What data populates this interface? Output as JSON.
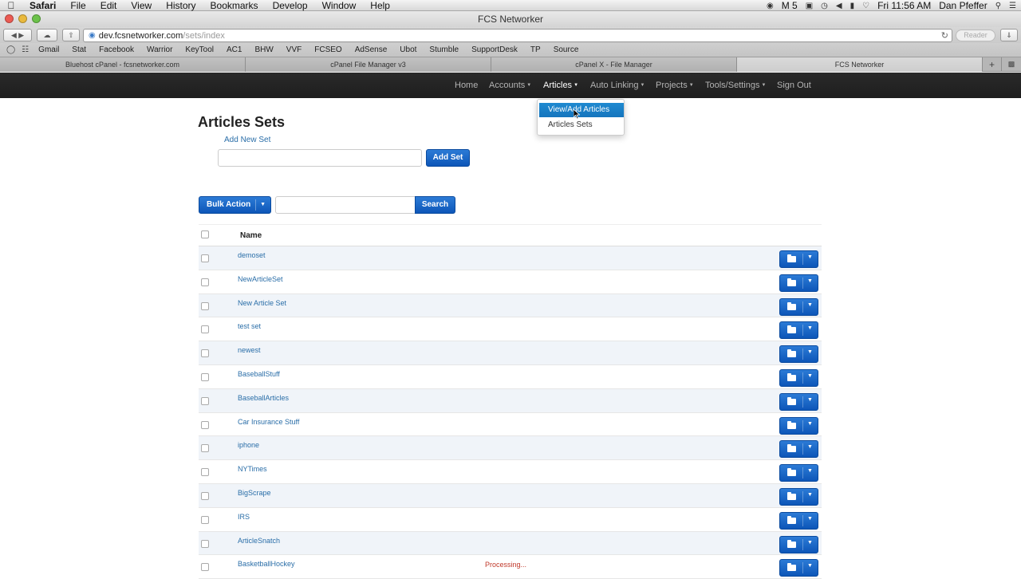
{
  "menubar": {
    "items": [
      "Safari",
      "File",
      "Edit",
      "View",
      "History",
      "Bookmarks",
      "Develop",
      "Window",
      "Help"
    ],
    "clock": "Fri 11:56 AM",
    "user": "Dan Pfeffer",
    "m5": "M 5"
  },
  "window": {
    "title": "FCS Networker"
  },
  "address": {
    "host": "dev.fcsnetworker.com",
    "path": "/sets/index",
    "reader": "Reader"
  },
  "bookmarks": [
    "Gmail",
    "Stat",
    "Facebook",
    "Warrior",
    "KeyTool",
    "AC1",
    "BHW",
    "VVF",
    "FCSEO",
    "AdSense",
    "Ubot",
    "Stumble",
    "SupportDesk",
    "TP",
    "Source"
  ],
  "tabs": [
    "Bluehost cPanel - fcsnetworker.com",
    "cPanel File Manager v3",
    "cPanel X - File Manager",
    "FCS Networker"
  ],
  "nav": {
    "home": "Home",
    "accounts": "Accounts",
    "articles": "Articles",
    "auto_linking": "Auto Linking",
    "projects": "Projects",
    "tools": "Tools/Settings",
    "signout": "Sign Out"
  },
  "dropdown": {
    "view_add": "View/Add Articles",
    "sets": "Articles Sets"
  },
  "page": {
    "title": "Articles Sets",
    "add_new": "Add New Set",
    "add_set_btn": "Add Set",
    "bulk_btn": "Bulk Action",
    "search_btn": "Search",
    "col_name": "Name"
  },
  "rows": [
    {
      "name": "demoset",
      "status": ""
    },
    {
      "name": "NewArticleSet",
      "status": ""
    },
    {
      "name": "New Article Set",
      "status": ""
    },
    {
      "name": "test set",
      "status": ""
    },
    {
      "name": "newest",
      "status": ""
    },
    {
      "name": "BaseballStuff",
      "status": ""
    },
    {
      "name": "BaseballArticles",
      "status": ""
    },
    {
      "name": "Car Insurance Stuff",
      "status": ""
    },
    {
      "name": "iphone",
      "status": ""
    },
    {
      "name": "NYTimes",
      "status": ""
    },
    {
      "name": "BigScrape",
      "status": ""
    },
    {
      "name": "IRS",
      "status": ""
    },
    {
      "name": "ArticleSnatch",
      "status": ""
    },
    {
      "name": "BasketballHockey",
      "status": "Processing..."
    }
  ]
}
